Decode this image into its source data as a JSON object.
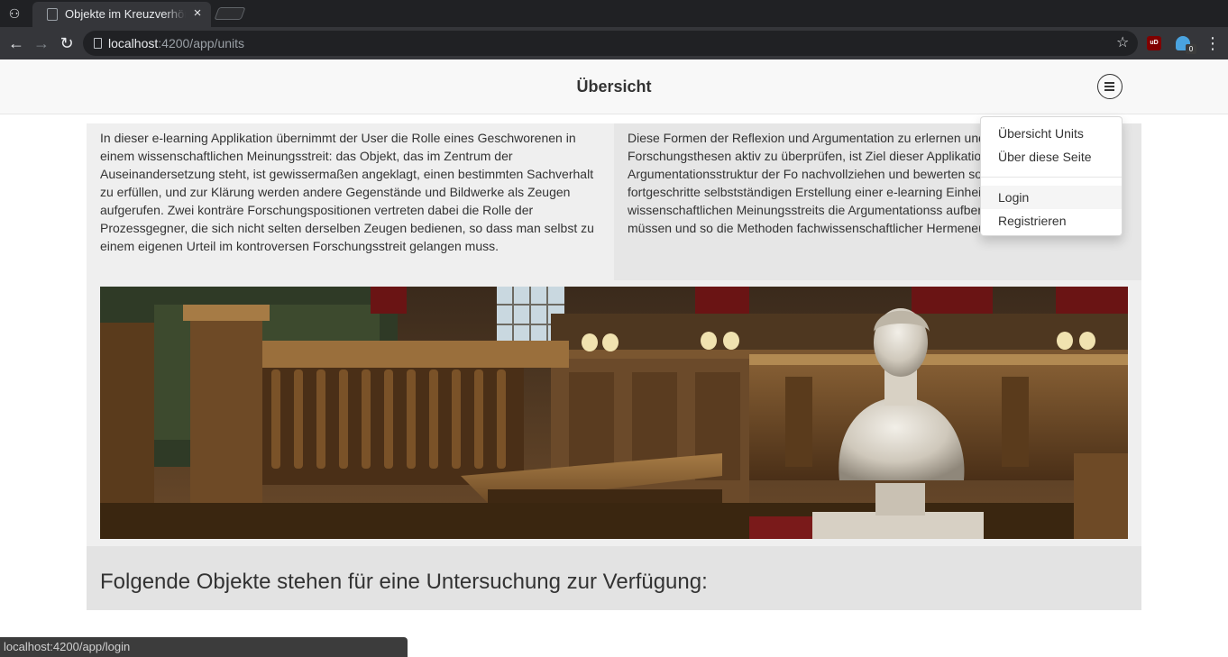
{
  "browser": {
    "tab_title": "Objekte im Kreuzverhör",
    "tab_close": "×",
    "url_host": "localhost",
    "url_path": ":4200/app/units",
    "status_url": "localhost:4200/app/login",
    "ghostery_badge": "0",
    "ublock_label": "uD"
  },
  "header": {
    "title": "Übersicht"
  },
  "intro": {
    "left_text": "In dieser e-learning Applikation übernimmt der User die Rolle eines Geschworenen in einem wissenschaftlichen Meinungsstreit: das Objekt, das im Zentrum der Auseinandersetzung steht, ist gewissermaßen angeklagt, einen bestimmten Sachverhalt zu erfüllen, und zur Klärung werden andere Gegenstände und Bildwerke als Zeugen aufgerufen. Zwei konträre Forschungspositionen vertreten dabei die Rolle der Prozessgegner, die sich nicht selten derselben Zeugen bedienen, so dass man selbst zu einem eigenen Urteil im kontroversen Forschungsstreit gelangen muss.",
    "right_text": "Diese Formen der Reflexion und Argumentation zu erlernen und umstrittenen Forschungsthesen aktiv zu überprüfen, ist Ziel dieser Applikation, wobei Anfänger die Argumentationsstruktur der Fo nachvollziehen und bewerten sollen, während die fortgeschritte selbstständigen Erstellung einer e-learning Einheit durch die m eines wissenschaftlichen Meinungsstreits die Argumentationss aufbereiten und ergänzen müssen und so die Methoden fachwissenschaftlicher Hermeneutik aktiv anwenden."
  },
  "objects": {
    "heading": "Folgende Objekte stehen für eine Untersuchung zur Verfügung:"
  },
  "dropdown": {
    "items": [
      "Übersicht Units",
      "Über diese Seite",
      "Login",
      "Registrieren"
    ]
  },
  "colors": {
    "header_bg": "#f8f8f8",
    "intro_left_bg": "#efefef",
    "intro_right_bg": "#e6e6e6",
    "objects_bg": "#e3e3e3",
    "text": "#333333"
  }
}
